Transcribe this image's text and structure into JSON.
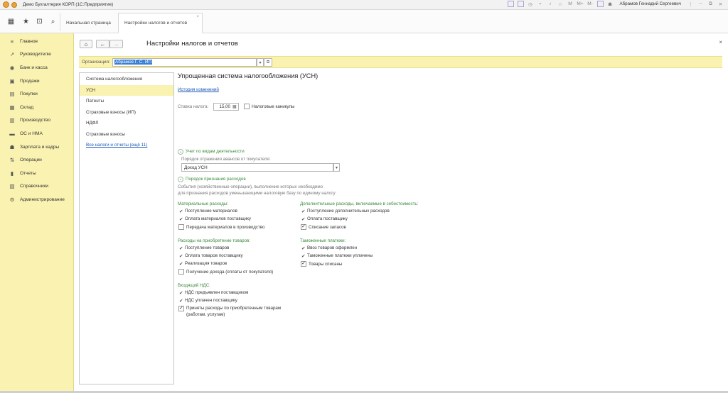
{
  "window": {
    "title": "Демо Бухгалтерия КОРП (1С:Предприятие)",
    "user": "Абрамов Геннадий Сергеевич",
    "title_icons": [
      "save-icon",
      "print-icon",
      "history-icon",
      "search-icon",
      "bell-icon",
      "star-icon",
      "memo-m",
      "memo-mplus",
      "memo-mminus",
      "panel-icon"
    ],
    "memo_labels": [
      "M",
      "M+",
      "M-"
    ]
  },
  "tabs": [
    {
      "label": "Начальная страница"
    },
    {
      "label": "Настройки налогов и отчетов",
      "close": "×"
    }
  ],
  "sidebar": {
    "items": [
      {
        "label": "Главное",
        "icon": "≡"
      },
      {
        "label": "Руководителю",
        "icon": "↗"
      },
      {
        "label": "Банк и касса",
        "icon": "◉"
      },
      {
        "label": "Продажи",
        "icon": "▣"
      },
      {
        "label": "Покупки",
        "icon": "▤"
      },
      {
        "label": "Склад",
        "icon": "▦"
      },
      {
        "label": "Производство",
        "icon": "▥"
      },
      {
        "label": "ОС и НМА",
        "icon": "▬"
      },
      {
        "label": "Зарплата и кадры",
        "icon": "☗"
      },
      {
        "label": "Операции",
        "icon": "⇅"
      },
      {
        "label": "Отчеты",
        "icon": "▮"
      },
      {
        "label": "Справочники",
        "icon": "▧"
      },
      {
        "label": "Администрирование",
        "icon": "⚙"
      }
    ]
  },
  "form": {
    "title": "Настройки налогов и отчетов",
    "close": "×",
    "nav": {
      "home": "⌂",
      "back": "←",
      "forward": "→"
    },
    "organization": {
      "label": "Организация:",
      "value": "Абрамов Г. С. ИП",
      "dropdown": "▾",
      "open": "⧉"
    }
  },
  "left_list": {
    "items": [
      {
        "label": "Система налогообложения"
      },
      {
        "label": "УСН",
        "selected": true
      },
      {
        "label": "Патенты"
      },
      {
        "label": "Страховые взносы (ИП)"
      },
      {
        "label": "НДФЛ"
      },
      {
        "label": "Страховые взносы"
      },
      {
        "label": "Все налоги и отчеты (ещё 11)",
        "link": true
      }
    ]
  },
  "usn": {
    "title": "Упрощенная система налогообложения (УСН)",
    "history_link": "История изменений",
    "rate_label": "Ставка налога:",
    "rate_value": "15,00",
    "tax_holidays_label": "Налоговые каникулы",
    "tax_holidays_checked": false,
    "activity_section": "Учет по видам деятельности",
    "advance_label": "Порядок отражения авансов от покупателя:",
    "advance_value": "Доход УСН",
    "expense_section": "Порядок признания расходов",
    "expense_desc_1": "События (хозяйственные операции), выполнение которых необходимо",
    "expense_desc_2": "для признания расходов уменьшающими налоговую базу по единому налогу:",
    "material_title": "Материальные расходы:",
    "material": [
      {
        "label": "Поступление материалов",
        "mark": "tick"
      },
      {
        "label": "Оплата материалов поставщику",
        "mark": "tick"
      },
      {
        "label": "Передача материалов в производство",
        "mark": "box",
        "checked": false
      }
    ],
    "additional_title": "Дополнительные расходы, включаемые в себестоимость:",
    "additional": [
      {
        "label": "Поступление дополнительных расходов",
        "mark": "tick"
      },
      {
        "label": "Оплата поставщику",
        "mark": "tick"
      },
      {
        "label": "Списание запасов",
        "mark": "box",
        "checked": true
      }
    ],
    "goods_title": "Расходы на приобретение товаров:",
    "goods": [
      {
        "label": "Поступление товаров",
        "mark": "tick"
      },
      {
        "label": "Оплата товаров поставщику",
        "mark": "tick"
      },
      {
        "label": "Реализация товаров",
        "mark": "tick"
      },
      {
        "label": "Получение дохода (оплаты от покупателя)",
        "mark": "box",
        "checked": false
      }
    ],
    "customs_title": "Таможенные платежи:",
    "customs": [
      {
        "label": "Ввоз товаров оформлен",
        "mark": "tick"
      },
      {
        "label": "Таможенные платежи уплачены",
        "mark": "tick"
      },
      {
        "label": "Товары списаны",
        "mark": "box",
        "checked": true
      }
    ],
    "vat_title": "Входящий НДС:",
    "vat": [
      {
        "label": "НДС предъявлен поставщиком",
        "mark": "tick"
      },
      {
        "label": "НДС уплачен поставщику",
        "mark": "tick"
      },
      {
        "label": "Приняты расходы по приобретенным товарам",
        "label2": "(работам, услугам)",
        "mark": "box",
        "checked": true
      }
    ]
  }
}
